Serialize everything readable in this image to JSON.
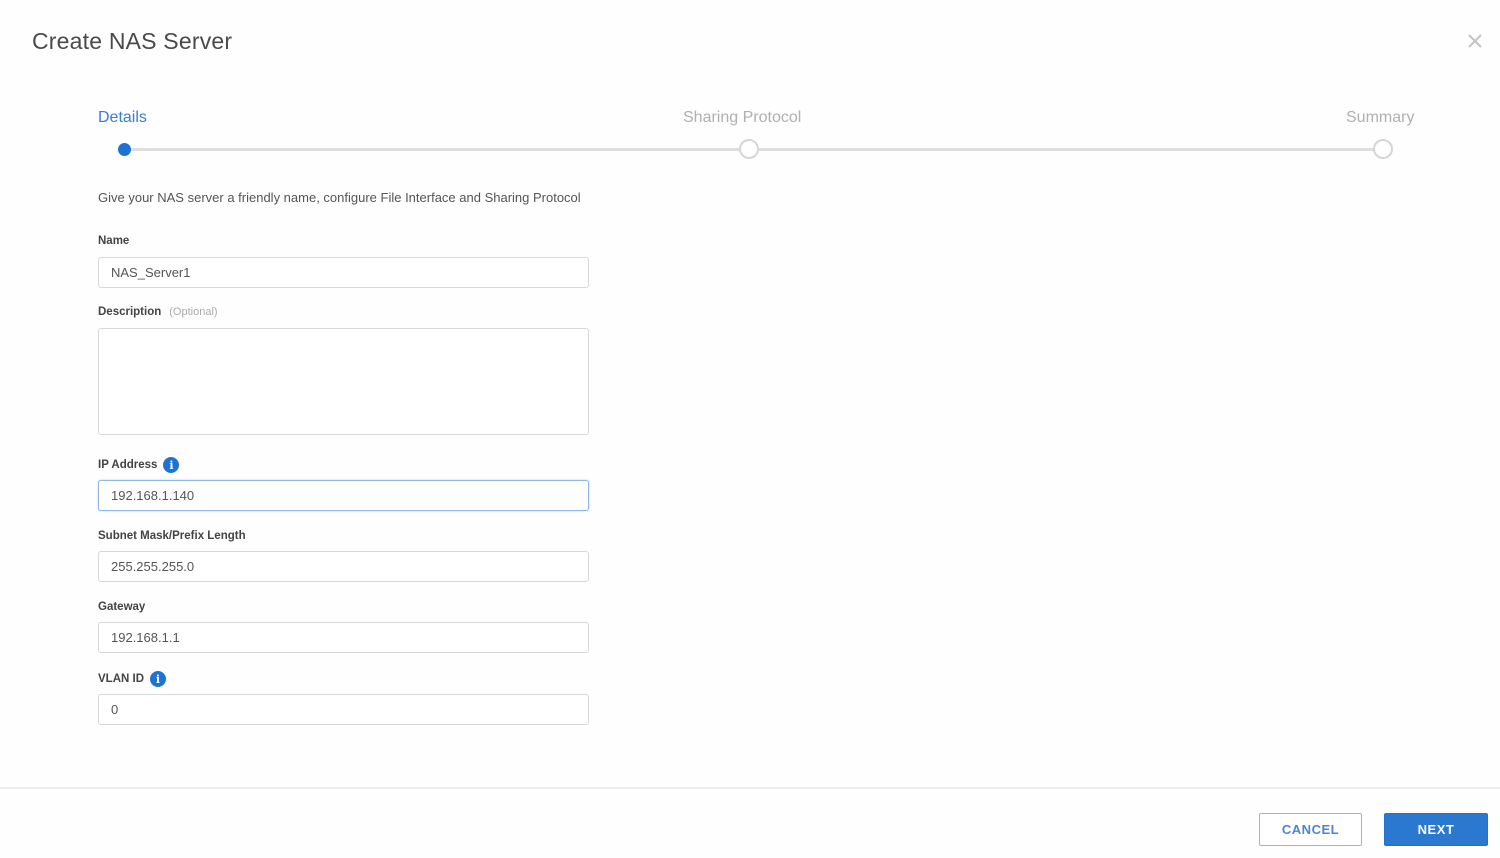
{
  "dialog": {
    "title": "Create NAS Server",
    "close_icon": "close-icon"
  },
  "wizard": {
    "steps": [
      {
        "label": "Details",
        "state": "active"
      },
      {
        "label": "Sharing Protocol",
        "state": "pending"
      },
      {
        "label": "Summary",
        "state": "pending"
      }
    ],
    "accent_color": "#1e73d2"
  },
  "form": {
    "intro": "Give your NAS server a friendly name, configure File Interface and Sharing Protocol",
    "name": {
      "label": "Name",
      "value": "NAS_Server1"
    },
    "description": {
      "label": "Description",
      "optional": "(Optional)",
      "value": ""
    },
    "ip_address": {
      "label": "IP Address",
      "value": "192.168.1.140",
      "info_icon": "info-icon"
    },
    "subnet": {
      "label": "Subnet Mask/Prefix Length",
      "value": "255.255.255.0"
    },
    "gateway": {
      "label": "Gateway",
      "value": "192.168.1.1"
    },
    "vlan": {
      "label": "VLAN ID",
      "value": "0",
      "info_icon": "info-icon"
    }
  },
  "footer": {
    "cancel_label": "CANCEL",
    "next_label": "NEXT"
  }
}
